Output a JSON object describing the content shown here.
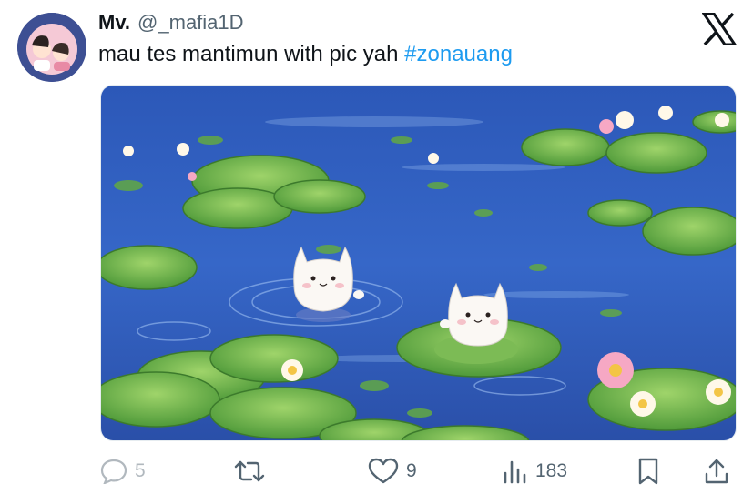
{
  "author": {
    "display_name": "Mv.",
    "handle": "@_mafia1D"
  },
  "tweet": {
    "text_main": "mau tes mantimun with pic yah",
    "hashtag": "#zonauang"
  },
  "media": {
    "alt_subject": "two white cats in a lily pond"
  },
  "actions": {
    "replies": "5",
    "retweets": "",
    "likes": "9",
    "views": "183"
  },
  "icons": {
    "platform_logo": "x-logo-icon",
    "reply": "speech-bubble-icon",
    "retweet": "retweet-icon",
    "like": "heart-icon",
    "views": "bar-chart-icon",
    "bookmark": "bookmark-icon",
    "share": "share-upload-icon"
  },
  "colors": {
    "accent": "#1d9bf0",
    "text": "#0f1419",
    "muted": "#536471"
  }
}
